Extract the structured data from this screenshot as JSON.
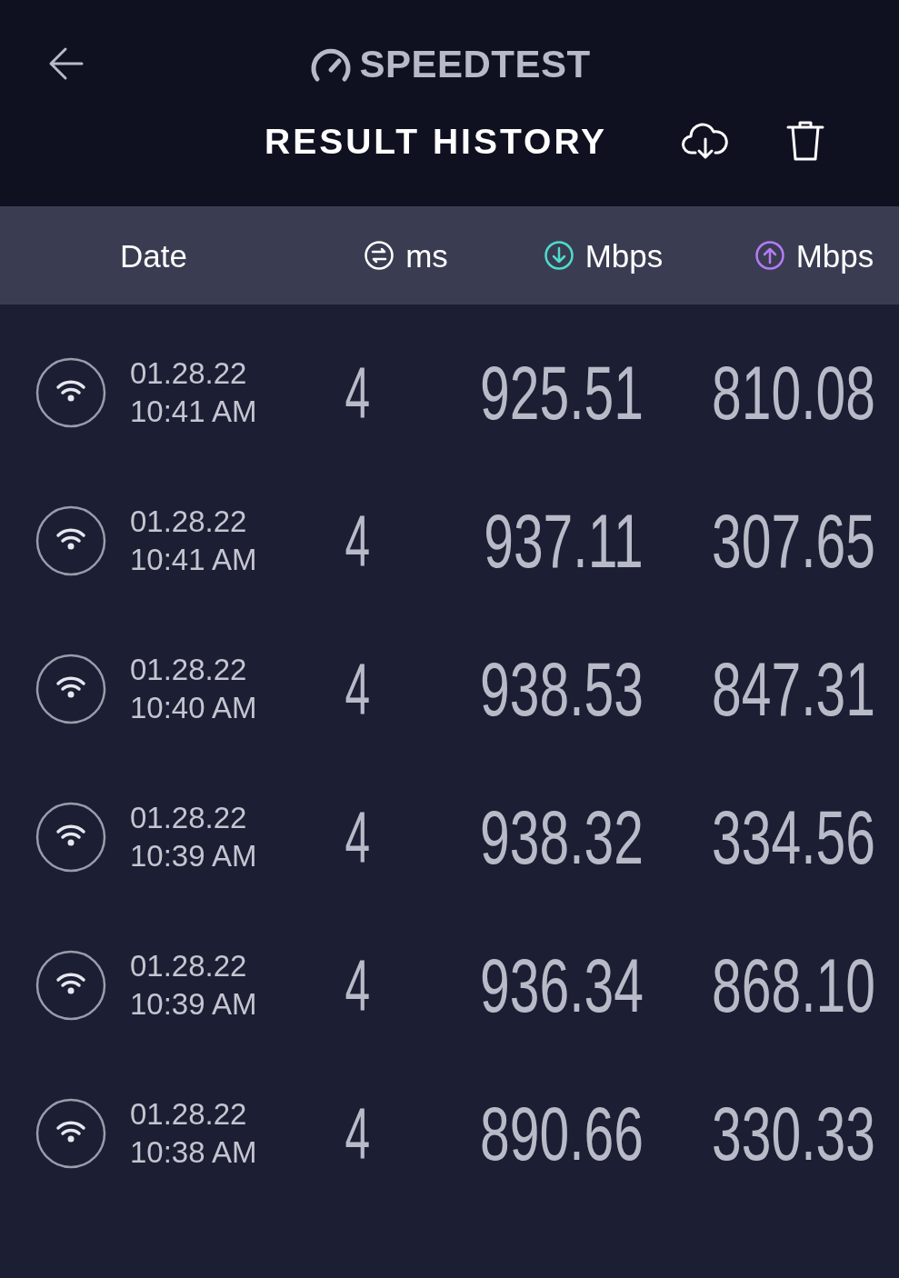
{
  "header": {
    "logo": "SPEEDTEST",
    "title": "RESULT HISTORY"
  },
  "columns": [
    {
      "kind": "date",
      "label": "Date"
    },
    {
      "kind": "ping",
      "label": "ms"
    },
    {
      "kind": "download",
      "label": "Mbps",
      "color": "#4fdccc"
    },
    {
      "kind": "upload",
      "label": "Mbps",
      "color": "#b57cf5"
    }
  ],
  "rows": [
    {
      "date": "01.28.22",
      "time": "10:41 AM",
      "ping": "4",
      "download": "925.51",
      "upload": "810.08"
    },
    {
      "date": "01.28.22",
      "time": "10:41 AM",
      "ping": "4",
      "download": "937.11",
      "upload": "307.65"
    },
    {
      "date": "01.28.22",
      "time": "10:40 AM",
      "ping": "4",
      "download": "938.53",
      "upload": "847.31"
    },
    {
      "date": "01.28.22",
      "time": "10:39 AM",
      "ping": "4",
      "download": "938.32",
      "upload": "334.56"
    },
    {
      "date": "01.28.22",
      "time": "10:39 AM",
      "ping": "4",
      "download": "936.34",
      "upload": "868.10"
    },
    {
      "date": "01.28.22",
      "time": "10:38 AM",
      "ping": "4",
      "download": "890.66",
      "upload": "330.33"
    }
  ]
}
